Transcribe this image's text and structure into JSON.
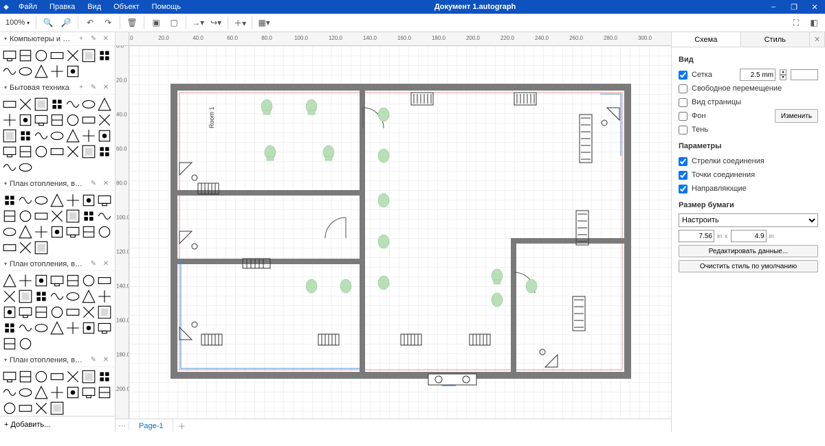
{
  "title": "Документ 1.autograph",
  "menu": [
    "Файл",
    "Правка",
    "Вид",
    "Объект",
    "Помощь"
  ],
  "window_controls": [
    "–",
    "❐",
    "✕"
  ],
  "toolbar": {
    "zoom": "100%",
    "zoom_in": "🔍+",
    "zoom_out": "🔍–"
  },
  "sidebar": {
    "categories": [
      {
        "name": "Компьютеры и мониторы",
        "shapes": 12
      },
      {
        "name": "Бытовая техника",
        "shapes": 30
      },
      {
        "name": "План отопления, вентиляции...",
        "shapes": 24
      },
      {
        "name": "План отопления, вентиляции...",
        "shapes": 30
      },
      {
        "name": "План отопления, вентиляции...",
        "shapes": 18
      }
    ],
    "add_label": "+  Добавить..."
  },
  "ruler_vals": [
    "0.0",
    "20.0",
    "40.0",
    "60.0",
    "80.0",
    "100.0",
    "120.0",
    "140.0",
    "160.0",
    "180.0",
    "200.0",
    "220.0",
    "240.0",
    "260.0",
    "280.0",
    "300.0"
  ],
  "page_tab": "Page-1",
  "room_label": "Room 1",
  "right": {
    "tabs": [
      "Схема",
      "Стиль"
    ],
    "sections": {
      "view_title": "Вид",
      "grid_label": "Сетка",
      "grid_val": "2.5 mm",
      "free_move": "Свободное перемещение",
      "page_view": "Вид страницы",
      "background": "Фон",
      "change_btn": "Изменить",
      "shadow": "Тень",
      "params_title": "Параметры",
      "conn_arrows": "Стрелки соединения",
      "conn_points": "Точки соединения",
      "guides": "Направляющие",
      "paper_title": "Размер бумаги",
      "paper_preset": "Настроить",
      "paper_w": "7.56",
      "paper_h": "4.9",
      "edit_data": "Редактировать данные...",
      "clear_style": "Очистить стиль по умолчанию"
    }
  }
}
